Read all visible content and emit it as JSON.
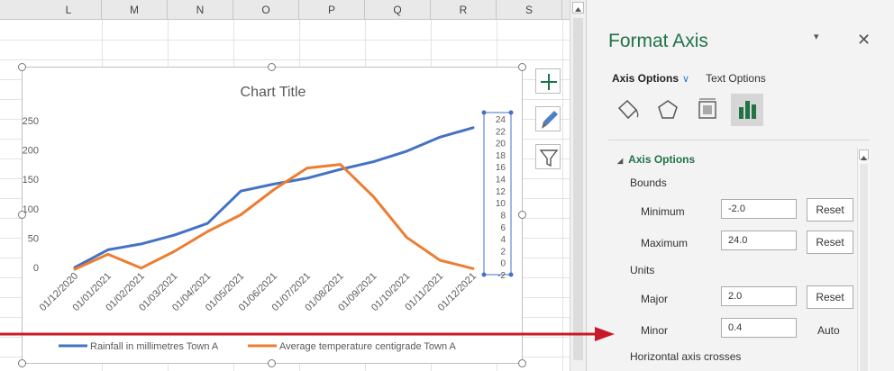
{
  "sheet": {
    "columns": [
      "L",
      "M",
      "N",
      "O",
      "P",
      "Q",
      "R",
      "S"
    ]
  },
  "chart": {
    "title": "Chart Title",
    "chart_data": {
      "type": "line",
      "title": "Chart Title",
      "categories": [
        "01/12/2020",
        "01/01/2021",
        "01/02/2021",
        "01/03/2021",
        "01/04/2021",
        "01/05/2021",
        "01/06/2021",
        "01/07/2021",
        "01/08/2021",
        "01/09/2021",
        "01/10/2021",
        "01/11/2021",
        "01/12/2021"
      ],
      "primary_axis": {
        "ylim": [
          0,
          250
        ],
        "ticks": [
          "250",
          "200",
          "150",
          "100",
          "50",
          "0"
        ]
      },
      "secondary_axis": {
        "ylim": [
          -2,
          24
        ],
        "ticks": [
          "24",
          "22",
          "20",
          "18",
          "16",
          "14",
          "12",
          "10",
          "8",
          "6",
          "4",
          "2",
          "0",
          "-2"
        ]
      },
      "series": [
        {
          "name": "Rainfall in millimetres Town A",
          "axis": "primary",
          "color": "#4472c4",
          "values": [
            0,
            30,
            40,
            55,
            75,
            130,
            142,
            152,
            167,
            180,
            198,
            222,
            238
          ]
        },
        {
          "name": "Average temperature centigrade Town A",
          "axis": "secondary",
          "color": "#ed7d31",
          "values": [
            -1.1,
            1.4,
            -0.9,
            1.9,
            5.2,
            8.0,
            12.2,
            15.8,
            16.4,
            11.0,
            4.2,
            0.4,
            -1.0
          ]
        }
      ],
      "legend": "bottom",
      "grid": false
    }
  },
  "side_buttons": [
    "plus-icon",
    "brush-icon",
    "filter-icon"
  ],
  "panel": {
    "title": "Format Axis",
    "dropdown_glyph": "▾",
    "close_glyph": "✕",
    "tab_axis_options": "Axis Options",
    "tab_chevron": "∨",
    "tab_text_options": "Text Options",
    "section_label": "Axis Options",
    "section_glyph": "◢",
    "bounds_label": "Bounds",
    "minimum_label": "Minimum",
    "minimum_value": "-2.0",
    "maximum_label": "Maximum",
    "maximum_value": "24.0",
    "units_label": "Units",
    "major_label": "Major",
    "major_value": "2.0",
    "minor_label": "Minor",
    "minor_value": "0.4",
    "reset_label": "Reset",
    "auto_label": "Auto",
    "h_axis_crosses_label": "Horizontal axis crosses"
  },
  "colors": {
    "accent": "#217346",
    "rainfall": "#4472c4",
    "temperature": "#ed7d31",
    "arrow": "#c8192b"
  }
}
